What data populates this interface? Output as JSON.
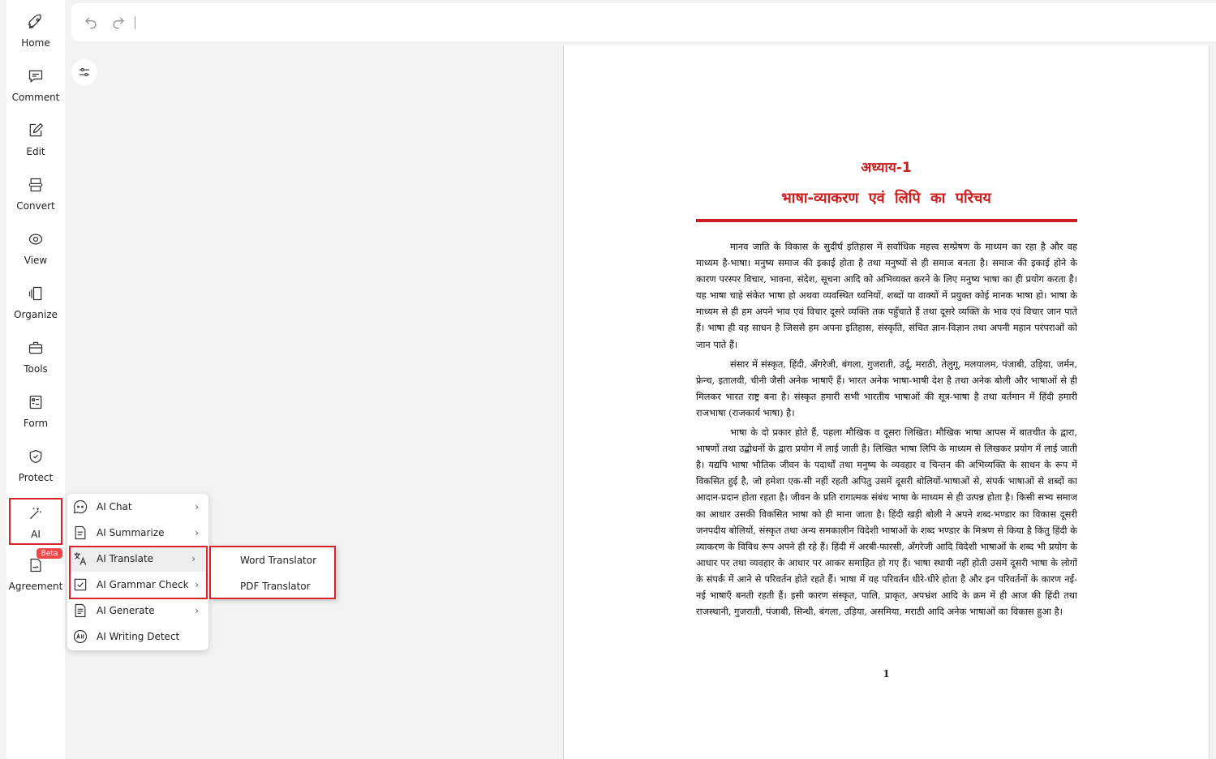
{
  "sidebar": {
    "items": [
      {
        "label": "Home",
        "icon": "rocket-icon"
      },
      {
        "label": "Comment",
        "icon": "comment-icon"
      },
      {
        "label": "Edit",
        "icon": "edit-icon"
      },
      {
        "label": "Convert",
        "icon": "convert-icon"
      },
      {
        "label": "View",
        "icon": "view-icon"
      },
      {
        "label": "Organize",
        "icon": "organize-icon"
      },
      {
        "label": "Tools",
        "icon": "toolbox-icon"
      },
      {
        "label": "Form",
        "icon": "form-icon"
      },
      {
        "label": "Protect",
        "icon": "shield-icon"
      },
      {
        "label": "AI",
        "icon": "magic-wand-icon",
        "active": true
      },
      {
        "label": "Agreement",
        "icon": "agreement-icon",
        "badge": "Beta"
      }
    ]
  },
  "ai_menu": {
    "items": [
      {
        "label": "AI Chat",
        "icon": "chat-bot-icon",
        "has_submenu": true
      },
      {
        "label": "AI Summarize",
        "icon": "summarize-icon",
        "has_submenu": true
      },
      {
        "label": "AI Translate",
        "icon": "translate-icon",
        "has_submenu": true,
        "hovered": true
      },
      {
        "label": "AI Grammar Check",
        "icon": "grammar-check-icon",
        "has_submenu": true
      },
      {
        "label": "AI Generate",
        "icon": "generate-icon",
        "has_submenu": true
      },
      {
        "label": "AI Writing Detect",
        "icon": "ai-detect-icon",
        "has_submenu": false
      }
    ],
    "chevron": "›"
  },
  "translate_submenu": {
    "items": [
      "Word Translator",
      "PDF Translator"
    ]
  },
  "toolbar": {
    "undo_icon": "undo-icon",
    "redo_icon": "redo-icon"
  },
  "document": {
    "chapter": "अध्याय-1",
    "title": "भाषा-व्याकरण एवं लिपि का परिचय",
    "paragraphs": [
      "मानव जाति के विकास के सुदीर्घ इतिहास में सर्वाधिक महत्त्व सम्प्रेषण के माध्यम का रहा है और वह माध्यम है-भाषा। मनुष्य समाज की इकाई होता है तथा मनुष्यों से ही समाज बनता है। समाज की इकाई होने के कारण परस्पर विचार, भावना, संदेश, सूचना आदि को अभिव्यक्त करने के लिए मनुष्य भाषा का ही प्रयोग करता है। यह भाषा चाहे संकेत भाषा हो अथवा व्यवस्थित ध्वनियों, शब्दों या वाक्यों में प्रयुक्त कोई मानक भाषा हो। भाषा के माध्यम से ही हम अपने भाव एवं विचार दूसरे व्यक्ति तक पहुँचाते हैं तथा दूसरे व्यक्ति के भाव एवं विचार जान पाते हैं। भाषा ही वह साधन है जिससे हम अपना इतिहास, संस्कृति, संचित ज्ञान-विज्ञान तथा अपनी महान परंपराओं को जान पाते हैं।",
      "संसार में संस्कृत, हिंदी, अँगरेजी, बंगला, गुजराती, उर्दू, मराठी, तेलुगू, मलयालम, पंजाबी, उड़िया, जर्मन, फ्रेन्च, इतालवी, चीनी जैसी अनेक भाषाएँ हैं। भारत अनेक भाषा-भाषी देश है तथा अनेक बोली और भाषाओं से ही मिलकर भारत राष्ट्र बना है। संस्कृत हमारी सभी भारतीय भाषाओं की सूत्र-भाषा है तथा वर्तमान में हिंदी हमारी राजभाषा (राजकार्य भाषा) है।",
      "भाषा के दो प्रकार होते हैं, पहला मौखिक व दूसरा लिखित। मौखिक भाषा आपस में बातचीत के द्वारा, भाषणों तथा उद्बोधनों के द्वारा प्रयोग में लाई जाती है। लिखित भाषा लिपि के माध्यम से लिखकर प्रयोग में लाई जाती है। यद्यपि भाषा भौतिक जीवन के पदार्थों तथा मनुष्य के व्यवहार व चिन्तन की अभिव्यक्ति के साधन के रूप में विकसित हुई है, जो हमेशा एक-सी नहीं रहती अपितु उसमें दूसरी बोलियों-भाषाओं से, संपर्क भाषाओं से शब्दों का आदान-प्रदान होता रहता है। जीवन के प्रति रागात्मक संबंध भाषा के माध्यम से ही उत्पन्न होता है। किसी सभ्य समाज का आधार उसकी विकसित भाषा को ही माना जाता है। हिंदी खड़ी बोली ने अपने शब्द-भण्डार का विकास दूसरी जनपदीय बोलियों, संस्कृत तथा अन्य समकालीन विदेशी भाषाओं के शब्द भण्डार के मिश्रण से किया है किंतु हिंदी के व्याकरण के विविध रूप अपने ही रहे हैं। हिंदी में अरबी-फारसी, अँगरेजी आदि विदेशी भाषाओं के शब्द भी प्रयोग के आधार पर तथा व्यवहार के आधार पर आकर समाहित हो गए हैं। भाषा स्थायी नहीं होती उसमें दूसरी भाषा के लोगों के संपर्क में आने से परिवर्तन होते रहते हैं। भाषा में यह परिवर्तन धीरे-धीरे होता है और इन परिवर्तनों के कारण नई-नई भाषाएँ बनती रहती हैं। इसी कारण संस्कृत, पालि, प्राकृत, अपभ्रंश आदि के क्रम में ही आज की हिंदी तथा राजस्थानी, गुजराती, पंजाबी, सिन्धी, बंगला, उड़िया, असमिया, मराठी आदि अनेक भाषाओं का विकास हुआ है।"
    ],
    "page_number": "1"
  },
  "colors": {
    "accent_red": "#d8232a",
    "heading_red": "#c8201f",
    "beta_badge": "#ef4a4a"
  }
}
